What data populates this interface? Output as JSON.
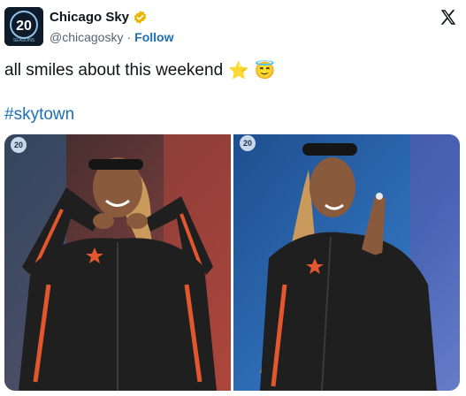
{
  "account": {
    "display_name": "Chicago Sky",
    "handle": "@chicagosky",
    "separator": "·",
    "follow_label": "Follow",
    "avatar_text": "20",
    "avatar_subtext": "SEASONS",
    "verified_color": "#e8b600"
  },
  "tweet": {
    "text": "all smiles about this weekend",
    "emojis": [
      "⭐",
      "😇"
    ],
    "hashtag": "#skytown"
  },
  "media": {
    "photos": [
      {
        "badge_text": "20",
        "jacket_color": "#1f1f1f",
        "accent_color": "#e4572e"
      },
      {
        "badge_text": "20",
        "jacket_color": "#1f1f1f",
        "accent_color": "#e4572e"
      }
    ]
  },
  "colors": {
    "link": "#1d6fb8",
    "secondary_text": "#536471"
  },
  "icons": {
    "platform": "x-logo-icon",
    "verified": "verified-badge-icon"
  }
}
